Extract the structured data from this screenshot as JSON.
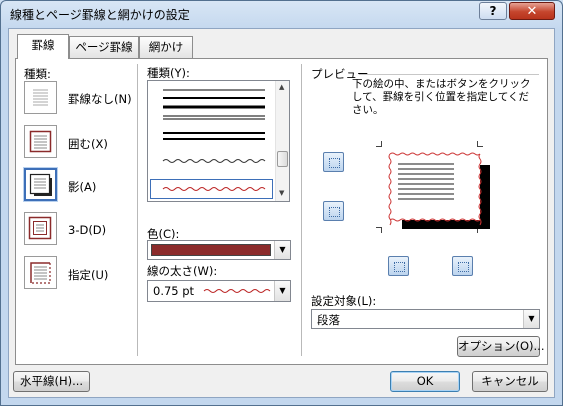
{
  "window": {
    "title": "線種とページ罫線と網かけの設定",
    "help_label": "?",
    "close_label": "✕"
  },
  "tabs": [
    {
      "label": "罫線",
      "active": true
    },
    {
      "label": "ページ罫線",
      "active": false
    },
    {
      "label": "網かけ",
      "active": false
    }
  ],
  "setting": {
    "heading": "種類:",
    "items": [
      {
        "label": "罫線なし(N)",
        "selected": false
      },
      {
        "label": "囲む(X)",
        "selected": false
      },
      {
        "label": "影(A)",
        "selected": true
      },
      {
        "label": "3-D(D)",
        "selected": false
      },
      {
        "label": "指定(U)",
        "selected": false
      }
    ]
  },
  "style": {
    "heading": "種類(Y):",
    "color_label": "色(C):",
    "color_value": "#8b2b2b",
    "width_label": "線の太さ(W):",
    "width_value": "0.75 pt",
    "selected_style": "wavy"
  },
  "preview": {
    "heading": "プレビュー",
    "hint": "下の絵の中、またはボタンをクリックして、罫線を引く位置を指定してください。",
    "apply_to_label": "設定対象(L):",
    "apply_to_value": "段落",
    "options_button": "オプション(O)..."
  },
  "footer": {
    "horizontal_line_button": "水平線(H)...",
    "ok_button": "OK",
    "cancel_button": "キャンセル"
  },
  "colors": {
    "accent": "#3d6fb8",
    "border_color": "#8b2b2b",
    "title_bar": "#c3d7ee"
  }
}
